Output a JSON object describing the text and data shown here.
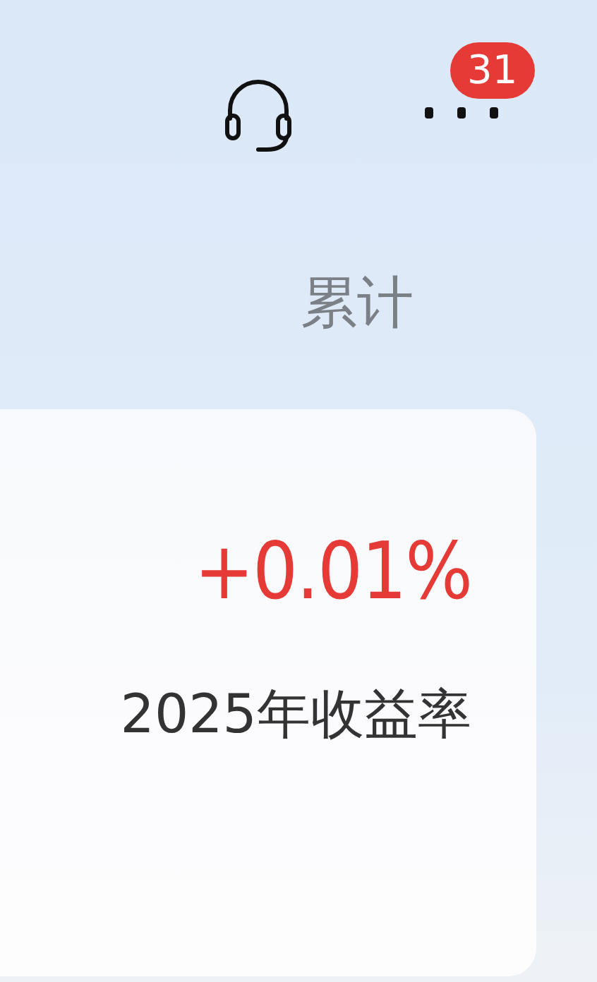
{
  "header": {
    "badge": "31"
  },
  "tab_label": "累计",
  "summary_card": {
    "value": "+0.01%",
    "caption": "2025年收益率"
  }
}
